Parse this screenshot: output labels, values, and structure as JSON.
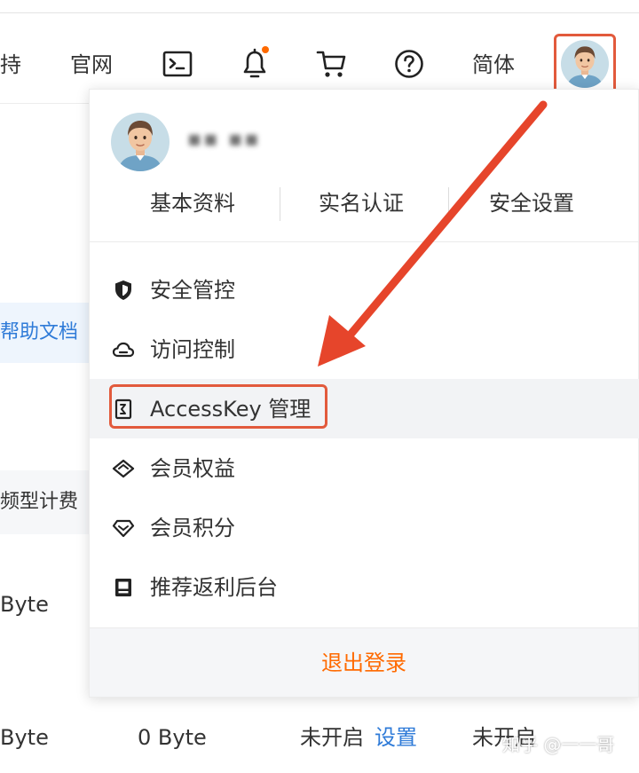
{
  "topbar": {
    "support_label": "持",
    "website_label": "官网",
    "language_label": "简体"
  },
  "icons": {
    "terminal": "terminal-icon",
    "bell": "bell-icon",
    "cart": "cart-icon",
    "help": "help-circle-icon",
    "avatar": "user-avatar"
  },
  "background": {
    "help_docs": "帮助文档",
    "col_header": "频型计费",
    "row1_value": "Byte",
    "row2_value": "Byte",
    "row2_col2": "0 Byte",
    "row2_status": "未开启",
    "row2_link": "设置",
    "row2_col4": "未开启"
  },
  "dropdown": {
    "username": "▪▪ ▪▪",
    "tabs": [
      "基本资料",
      "实名认证",
      "安全设置"
    ],
    "menu": [
      {
        "label": "安全管控",
        "icon": "shield-icon"
      },
      {
        "label": "访问控制",
        "icon": "cloud-icon"
      },
      {
        "label": "AccessKey 管理",
        "icon": "accesskey-icon"
      },
      {
        "label": "会员权益",
        "icon": "diamond-icon"
      },
      {
        "label": "会员积分",
        "icon": "gem-icon"
      },
      {
        "label": "推荐返利后台",
        "icon": "monitor-icon"
      }
    ],
    "logout": "退出登录"
  },
  "watermark": "知乎 @一一哥",
  "colors": {
    "accent": "#ff6a00",
    "annotation_red": "#e25a3c",
    "link_blue": "#2f7bd8"
  }
}
